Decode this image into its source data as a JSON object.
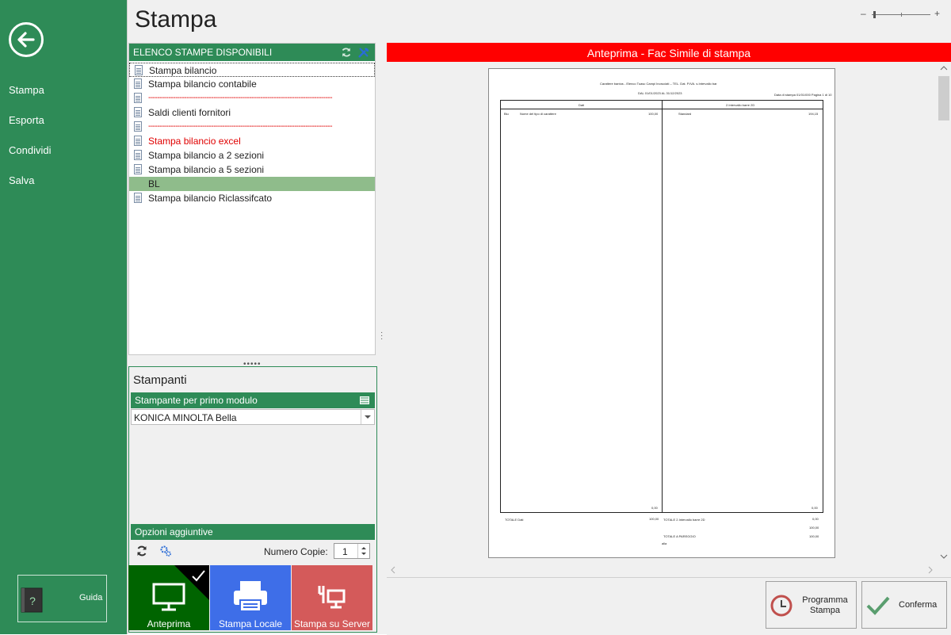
{
  "sidebar": {
    "items": [
      "Stampa",
      "Esporta",
      "Condividi",
      "Salva"
    ],
    "guida_label": "Guida"
  },
  "page_title": "Stampa",
  "zoom": {
    "minus": "–",
    "plus": "+"
  },
  "list": {
    "header": "ELENCO STAMPE DISPONIBILI",
    "items": [
      {
        "label": "Stampa bilancio"
      },
      {
        "label": "Stampa bilancio contabile"
      },
      {
        "label": "----------------------------------------------------------------------------------"
      },
      {
        "label": "Saldi clienti fornitori"
      },
      {
        "label": "----------------------------------------------------------------------------------"
      },
      {
        "label": "Stampa bilancio excel"
      },
      {
        "label": "Stampa bilancio a  2 sezioni"
      },
      {
        "label": "Stampa bilancio a  5 sezioni"
      },
      {
        "label": "BL"
      },
      {
        "label": "Stampa bilancio Riclassifcato"
      }
    ],
    "splitter": "•••••"
  },
  "printers": {
    "title": "Stampanti",
    "header": "Stampante per primo modulo",
    "selected": "KONICA MINOLTA Bella",
    "options_header": "Opzioni aggiuntive",
    "copies_label": "Numero Copie:",
    "copies_value": "1"
  },
  "tiles": {
    "preview": "Anteprima",
    "local": "Stampa Locale",
    "server": "Stampa su Server"
  },
  "preview": {
    "title": "Anteprima - Fac Simile di stampa",
    "doc": {
      "heading": "Carattere bantos - Elenco Tuasc Campi Inoruciati – TEL. Dat. P.IVA. s.Intervallo bar",
      "subheading": "DAL 01/01/2023 AL 31/12/2023",
      "page_info": "Data di stampa 01/01/000 Pagina 1 di 10",
      "col_left": "Dati",
      "col_right": "2.Intervallo barre 2D",
      "row_code": "Blu",
      "row_desc": "Nome del tipo di carattere",
      "row_val_left": "100,00",
      "row_right_desc": "Standard",
      "row_val_right": "194,15",
      "zero_left": "0,00",
      "zero_right": "0,00",
      "total_left_label": "TOTALE Dati",
      "total_left_value": "100,00",
      "total_right_label": "TOTALE 2.Intervallo barre 2D",
      "total_right_value": "0,00",
      "extra_value": "100,00",
      "passivo_label": "TOTALE A PAREGGIO",
      "passivo_value": "100,00",
      "alla": "alla"
    }
  },
  "buttons": {
    "schedule": "Programma\nStampa",
    "confirm": "Conferma"
  },
  "colors": {
    "accent_green": "#2e8b57",
    "preview_red": "#ff0000",
    "tile_preview": "#006400",
    "tile_local": "#3e6ee8",
    "tile_server": "#d45a5a"
  }
}
